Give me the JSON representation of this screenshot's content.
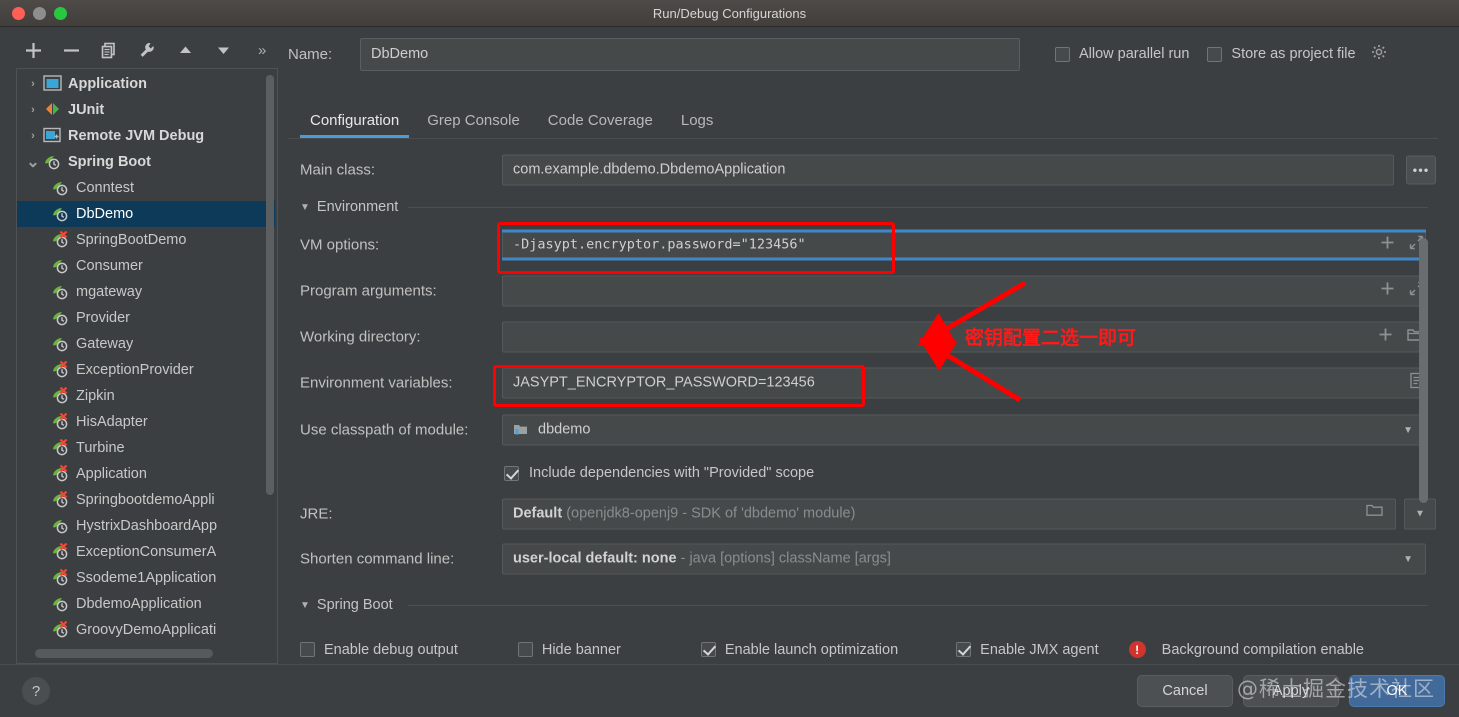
{
  "window": {
    "title": "Run/Debug Configurations",
    "traffic_lights": [
      "close",
      "minimize",
      "zoom"
    ]
  },
  "toolbar": {
    "buttons": [
      {
        "name": "add",
        "icon": "plus-icon"
      },
      {
        "name": "remove",
        "icon": "minus-icon"
      },
      {
        "name": "copy",
        "icon": "copy-icon"
      },
      {
        "name": "edit-templates",
        "icon": "wrench-icon"
      },
      {
        "name": "move-up",
        "icon": "arrow-up-icon"
      },
      {
        "name": "move-down",
        "icon": "arrow-down-icon"
      }
    ],
    "more_label": "»"
  },
  "sidebar": {
    "items": [
      {
        "label": "Application",
        "type": "group",
        "expanded": false,
        "icon": "application-icon",
        "error": false
      },
      {
        "label": "JUnit",
        "type": "group",
        "expanded": false,
        "icon": "junit-icon",
        "error": false
      },
      {
        "label": "Remote JVM Debug",
        "type": "group",
        "expanded": false,
        "icon": "remote-debug-icon",
        "error": false
      },
      {
        "label": "Spring Boot",
        "type": "group",
        "expanded": true,
        "icon": "spring-boot-icon",
        "error": false
      },
      {
        "label": "Conntest",
        "type": "leaf",
        "icon": "spring-boot-icon",
        "error": false,
        "selected": false
      },
      {
        "label": "DbDemo",
        "type": "leaf",
        "icon": "spring-boot-icon",
        "error": false,
        "selected": true
      },
      {
        "label": "SpringBootDemo",
        "type": "leaf",
        "icon": "spring-boot-icon",
        "error": true,
        "selected": false
      },
      {
        "label": "Consumer",
        "type": "leaf",
        "icon": "spring-boot-icon",
        "error": false,
        "selected": false
      },
      {
        "label": "mgateway",
        "type": "leaf",
        "icon": "spring-boot-icon",
        "error": false,
        "selected": false
      },
      {
        "label": "Provider",
        "type": "leaf",
        "icon": "spring-boot-icon",
        "error": false,
        "selected": false
      },
      {
        "label": "Gateway",
        "type": "leaf",
        "icon": "spring-boot-icon",
        "error": false,
        "selected": false
      },
      {
        "label": "ExceptionProvider",
        "type": "leaf",
        "icon": "spring-boot-icon",
        "error": true,
        "selected": false
      },
      {
        "label": "Zipkin",
        "type": "leaf",
        "icon": "spring-boot-icon",
        "error": true,
        "selected": false
      },
      {
        "label": "HisAdapter",
        "type": "leaf",
        "icon": "spring-boot-icon",
        "error": true,
        "selected": false
      },
      {
        "label": "Turbine",
        "type": "leaf",
        "icon": "spring-boot-icon",
        "error": true,
        "selected": false
      },
      {
        "label": "Application",
        "type": "leaf",
        "icon": "spring-boot-icon",
        "error": true,
        "selected": false
      },
      {
        "label": "SpringbootdemoAppli",
        "type": "leaf",
        "icon": "spring-boot-icon",
        "error": true,
        "selected": false
      },
      {
        "label": "HystrixDashboardApp",
        "type": "leaf",
        "icon": "spring-boot-icon",
        "error": false,
        "selected": false
      },
      {
        "label": "ExceptionConsumerA",
        "type": "leaf",
        "icon": "spring-boot-icon",
        "error": true,
        "selected": false
      },
      {
        "label": "Ssodeme1Application",
        "type": "leaf",
        "icon": "spring-boot-icon",
        "error": true,
        "selected": false
      },
      {
        "label": "DbdemoApplication",
        "type": "leaf",
        "icon": "spring-boot-icon",
        "error": false,
        "selected": false
      },
      {
        "label": "GroovyDemoApplicati",
        "type": "leaf",
        "icon": "spring-boot-icon",
        "error": true,
        "selected": false
      }
    ]
  },
  "name_field": {
    "label": "Name:",
    "value": "DbDemo"
  },
  "top_options": [
    {
      "label": "Allow parallel run",
      "checked": false
    },
    {
      "label": "Store as project file",
      "checked": false
    }
  ],
  "tabs": [
    {
      "label": "Configuration",
      "active": true
    },
    {
      "label": "Grep Console",
      "active": false
    },
    {
      "label": "Code Coverage",
      "active": false
    },
    {
      "label": "Logs",
      "active": false
    }
  ],
  "fields": {
    "main_class": {
      "label": "Main class:",
      "value": "com.example.dbdemo.DbdemoApplication",
      "browse": "•••"
    },
    "environment_section": "Environment",
    "vm_options": {
      "label": "VM options:",
      "value": "-Djasypt.encryptor.password=\"123456\"",
      "focused": true
    },
    "program_arguments": {
      "label": "Program arguments:",
      "value": ""
    },
    "working_directory": {
      "label": "Working directory:",
      "value": ""
    },
    "environment_variables": {
      "label": "Environment variables:",
      "value": "JASYPT_ENCRYPTOR_PASSWORD=123456"
    },
    "use_classpath": {
      "label": "Use classpath of module:",
      "value": "dbdemo"
    },
    "include_provided": {
      "label": "Include dependencies with \"Provided\" scope",
      "checked": true
    },
    "jre": {
      "label": "JRE:",
      "value_strong": "Default",
      "value_dim": "(openjdk8-openj9 - SDK of 'dbdemo' module)"
    },
    "shorten_command_line": {
      "label": "Shorten command line:",
      "value_strong": "user-local default: none",
      "value_dim": "- java [options] className [args]"
    },
    "spring_boot_section": "Spring Boot"
  },
  "spring_boot_options": [
    {
      "label": "Enable debug output",
      "checked": false,
      "error": false
    },
    {
      "label": "Hide banner",
      "checked": false,
      "error": false
    },
    {
      "label": "Enable launch optimization",
      "checked": true,
      "error": false
    },
    {
      "label": "Enable JMX agent",
      "checked": true,
      "error": false
    },
    {
      "label": "Background compilation enable",
      "checked": false,
      "error": true
    }
  ],
  "bottom": {
    "help_label": "?",
    "buttons": [
      {
        "label": "Cancel",
        "primary": false
      },
      {
        "label": "Apply",
        "primary": false
      },
      {
        "label": "OK",
        "primary": true
      }
    ]
  },
  "annotations": {
    "note_text": "密钥配置二选一即可",
    "color": "#ff0000",
    "boxes": [
      "vm-options-field",
      "environment-variables-field"
    ]
  },
  "watermark": "@稀土掘金技术社区",
  "colors": {
    "background": "#3c3f41",
    "selection": "#0d3a58",
    "accent": "#4d9bd6",
    "annotation": "#ff0000",
    "error": "#d0342c"
  }
}
